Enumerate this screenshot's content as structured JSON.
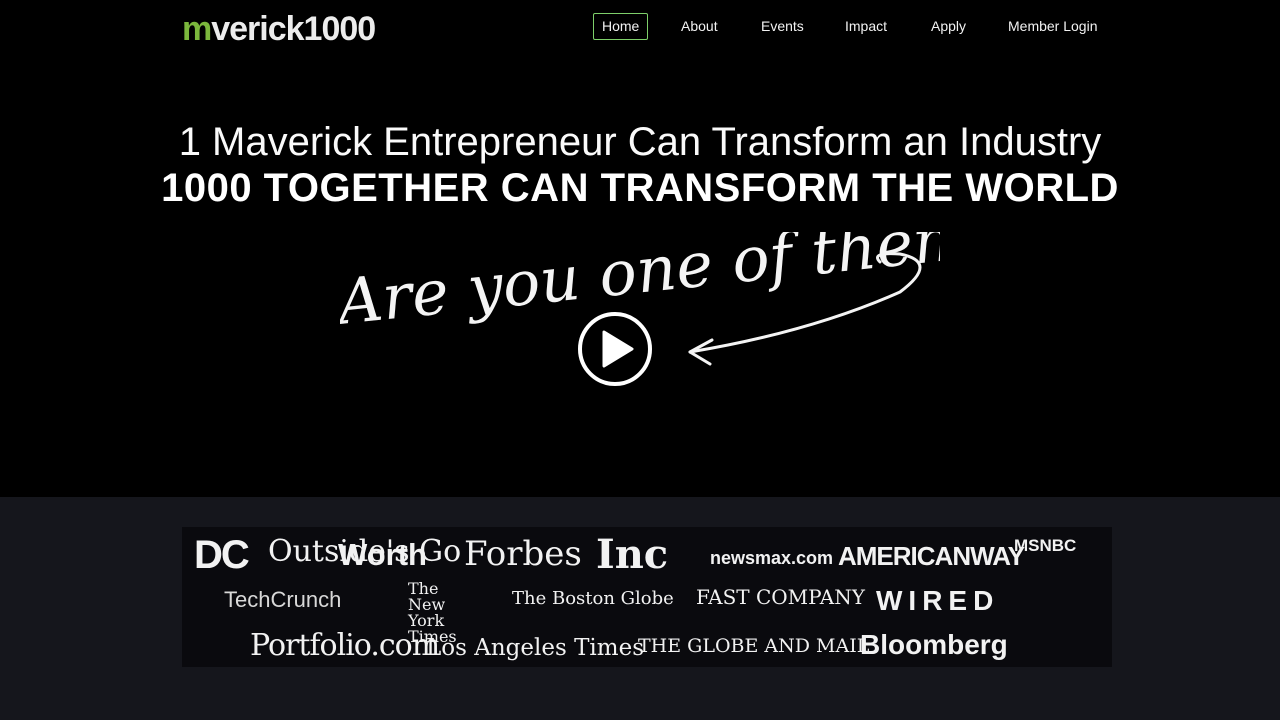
{
  "brand": {
    "logo_green": "m",
    "logo_white": "verick1000"
  },
  "nav": {
    "items": [
      {
        "label": "Home",
        "active": true
      },
      {
        "label": "About"
      },
      {
        "label": "Events"
      },
      {
        "label": "Impact"
      },
      {
        "label": "Apply"
      },
      {
        "label": "Member Login"
      }
    ]
  },
  "hero": {
    "line1": "1 Maverick Entrepreneur Can Transform an Industry",
    "line2": "1000 TOGETHER CAN TRANSFORM THE WORLD",
    "handwritten": "Are you one of them?"
  },
  "press": {
    "row1": [
      "DC",
      "Outside's Go",
      "Worth",
      "Forbes",
      "Inc",
      "newsmax.com",
      "AMERICANWAY",
      "MSNBC"
    ],
    "row2": [
      "TechCrunch",
      "The New York Times",
      "The Boston Globe",
      "FAST COMPANY",
      "WIRED"
    ],
    "row3": [
      "Portfolio.com",
      "Los Angeles Times",
      "THE GLOBE AND MAIL",
      "Bloomberg"
    ]
  },
  "colors": {
    "accent_green": "#7bb73c",
    "nav_active_border": "#7ecf6a",
    "press_band": "#15161c"
  }
}
